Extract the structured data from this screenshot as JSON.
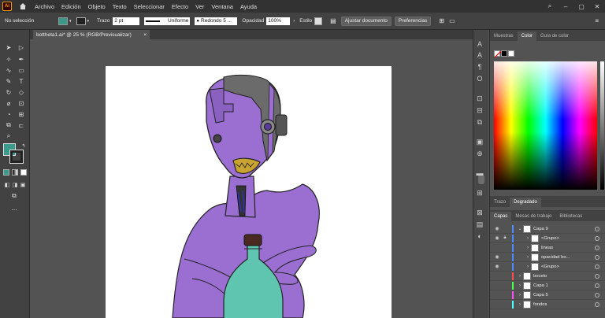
{
  "menu": {
    "logo": "Ai",
    "items": [
      "Archivo",
      "Edición",
      "Objeto",
      "Texto",
      "Seleccionar",
      "Efecto",
      "Ver",
      "Ventana",
      "Ayuda"
    ]
  },
  "control": {
    "selection": "No selección",
    "stroke_label": "Trazo",
    "stroke_value": "2 pt",
    "profile": "Uniforme",
    "brush": "Redondo 5 ...",
    "opacity_label": "Opacidad",
    "opacity_value": "100%",
    "style_label": "Estilo",
    "adjust_btn": "Ajustar documento",
    "prefs_btn": "Preferencias"
  },
  "document": {
    "tab_title": "bottheta1.ai* @ 25 % (RGB/Previsualizar)",
    "close": "×"
  },
  "panels": {
    "color_tabs": [
      "Muestras",
      "Color",
      "Guía de color"
    ],
    "mid_tabs": [
      "Trazo",
      "Degradado"
    ],
    "layer_tabs": [
      "Capas",
      "Mesas de trabajo",
      "Bibliotecas"
    ]
  },
  "layers": [
    {
      "name": "Capa 9",
      "visible": true,
      "locked": false,
      "indent": 0,
      "expanded": true,
      "color": "#4f8cff"
    },
    {
      "name": "<Grupo>",
      "visible": true,
      "locked": true,
      "indent": 1,
      "expanded": false,
      "color": "#4f8cff"
    },
    {
      "name": "lineas",
      "visible": false,
      "locked": false,
      "indent": 1,
      "expanded": false,
      "color": "#4f8cff"
    },
    {
      "name": "opacidad bo...",
      "visible": true,
      "locked": false,
      "indent": 1,
      "expanded": false,
      "color": "#4f8cff"
    },
    {
      "name": "<Grupo>",
      "visible": true,
      "locked": false,
      "indent": 1,
      "expanded": false,
      "color": "#4f8cff"
    },
    {
      "name": "boceto",
      "visible": false,
      "locked": false,
      "indent": 0,
      "expanded": false,
      "color": "#ff4f4f"
    },
    {
      "name": "Capa 1",
      "visible": false,
      "locked": false,
      "indent": 0,
      "expanded": false,
      "color": "#4fff4f"
    },
    {
      "name": "Capa 5",
      "visible": false,
      "locked": false,
      "indent": 0,
      "expanded": false,
      "color": "#ff4fff"
    },
    {
      "name": "fondos",
      "visible": false,
      "locked": false,
      "indent": 0,
      "expanded": false,
      "color": "#4fffff"
    }
  ],
  "colors": {
    "fill": "#3a9a8c",
    "skin": "#9b6fd1",
    "bottle": "#5fc4b0",
    "cork": "#4a2a20"
  }
}
